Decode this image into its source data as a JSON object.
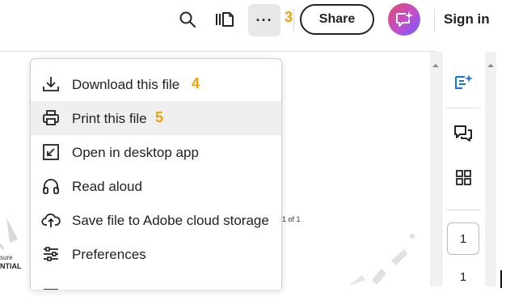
{
  "toolbar": {
    "more_label": "···",
    "more_annotation": "3",
    "share_label": "Share",
    "signin_label": "Sign in"
  },
  "menu": {
    "items": [
      {
        "label": "Download this file",
        "icon": "download-icon",
        "annotation": "4"
      },
      {
        "label": "Print this file",
        "icon": "printer-icon",
        "annotation": "5"
      },
      {
        "label": "Open in desktop app",
        "icon": "open-external-icon"
      },
      {
        "label": "Read aloud",
        "icon": "headphones-icon"
      },
      {
        "label": "Save file to Adobe cloud storage",
        "icon": "cloud-upload-icon"
      },
      {
        "label": "Preferences",
        "icon": "sliders-icon"
      }
    ]
  },
  "document": {
    "page_indicator": "1 of 1",
    "fragment_sure": "sure",
    "fragment_ntial": "NTIAL"
  },
  "rail": {
    "current_page": "1",
    "next_page": "1"
  },
  "colors": {
    "annotation": "#f0a000",
    "ai_gradient_start": "#e04a6b",
    "ai_gradient_end": "#6a5cff"
  }
}
